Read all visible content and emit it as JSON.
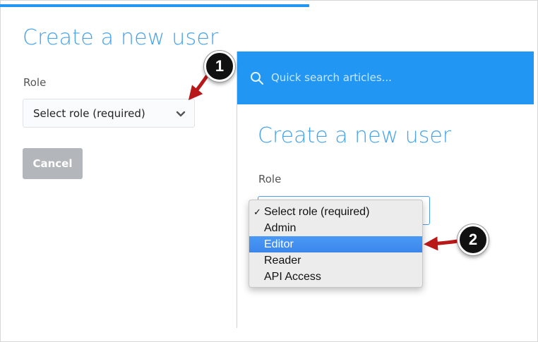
{
  "left": {
    "title": "Create a new user",
    "role_label": "Role",
    "select_value": "Select role (required)",
    "cancel_label": "Cancel"
  },
  "right": {
    "search_placeholder": "Quick search articles...",
    "title": "Create a new user",
    "role_label": "Role",
    "dropdown": {
      "check_mark": "✓",
      "options": [
        "Select role (required)",
        "Admin",
        "Editor",
        "Reader",
        "API Access"
      ],
      "checked_option": "Select role (required)",
      "highlighted_option": "Editor"
    }
  },
  "callouts": [
    "1",
    "2"
  ],
  "colors": {
    "accent": "#2196f3",
    "title": "#46a3ec",
    "highlight": "#3b86ec",
    "arrow": "#b81818",
    "cancel_bg": "#b3b6ba"
  }
}
